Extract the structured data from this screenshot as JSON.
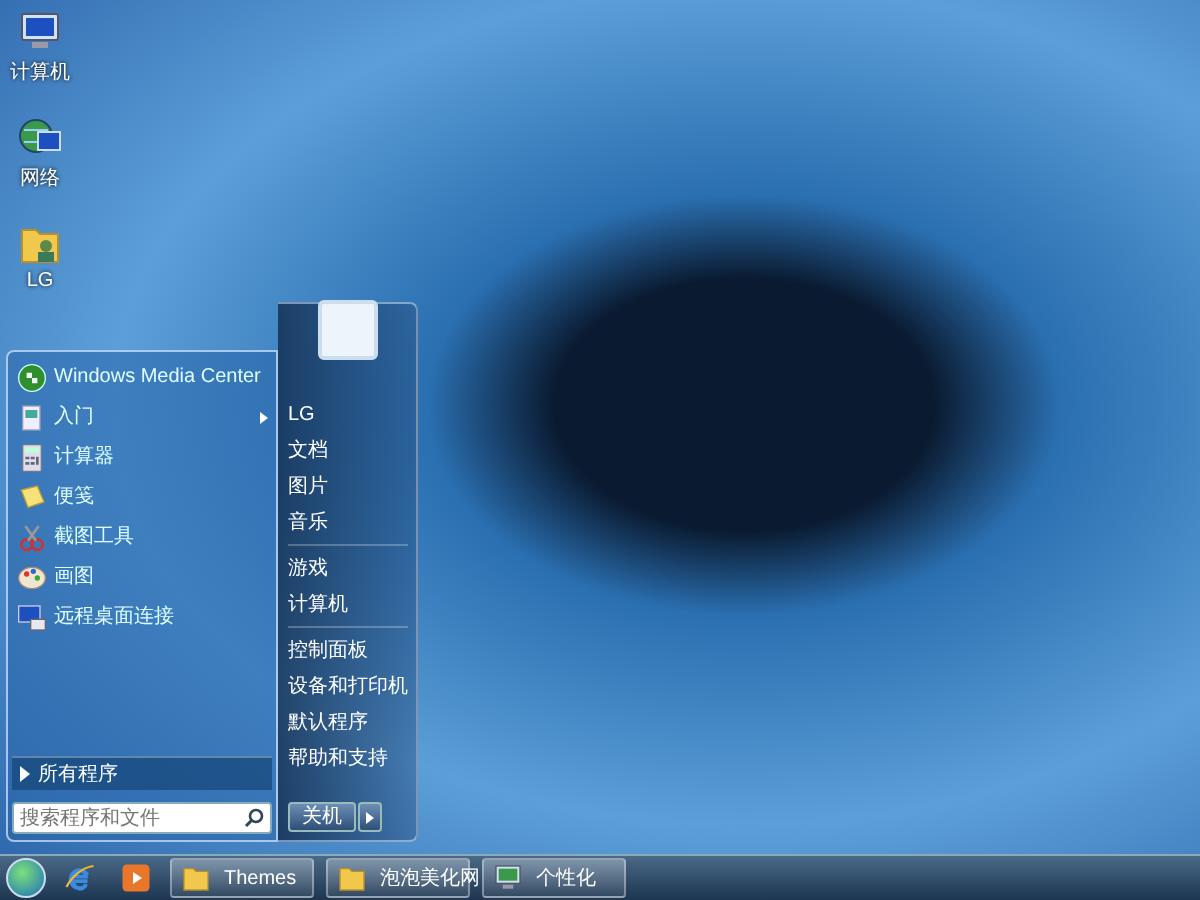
{
  "desktop_icons": [
    {
      "label": "计算机",
      "kind": "computer"
    },
    {
      "label": "网络",
      "kind": "network"
    },
    {
      "label": "LG",
      "kind": "user-folder"
    }
  ],
  "start_menu": {
    "programs": [
      {
        "label": "Windows Media Center",
        "kind": "media-center",
        "submenu": false
      },
      {
        "label": "入门",
        "kind": "getting-started",
        "submenu": true
      },
      {
        "label": "计算器",
        "kind": "calculator",
        "submenu": false
      },
      {
        "label": "便笺",
        "kind": "notes",
        "submenu": false
      },
      {
        "label": "截图工具",
        "kind": "snipping",
        "submenu": false
      },
      {
        "label": "画图",
        "kind": "paint",
        "submenu": false
      },
      {
        "label": "远程桌面连接",
        "kind": "remote",
        "submenu": false
      }
    ],
    "all_programs": "所有程序",
    "search": {
      "placeholder": "搜索程序和文件"
    },
    "place_groups": [
      {
        "items": [
          "LG",
          "文档",
          "图片",
          "音乐"
        ]
      },
      {
        "items": [
          "游戏",
          "计算机"
        ]
      },
      {
        "items": [
          "控制面板",
          "设备和打印机",
          "默认程序",
          "帮助和支持"
        ]
      }
    ],
    "shutdown": "关机"
  },
  "taskbar": {
    "pinned": [
      {
        "kind": "browser"
      },
      {
        "kind": "media-player"
      }
    ],
    "buttons": [
      {
        "label": "Themes",
        "kind": "folder"
      },
      {
        "label": "泡泡美化网",
        "kind": "folder"
      },
      {
        "label": "个性化",
        "kind": "display"
      }
    ]
  }
}
